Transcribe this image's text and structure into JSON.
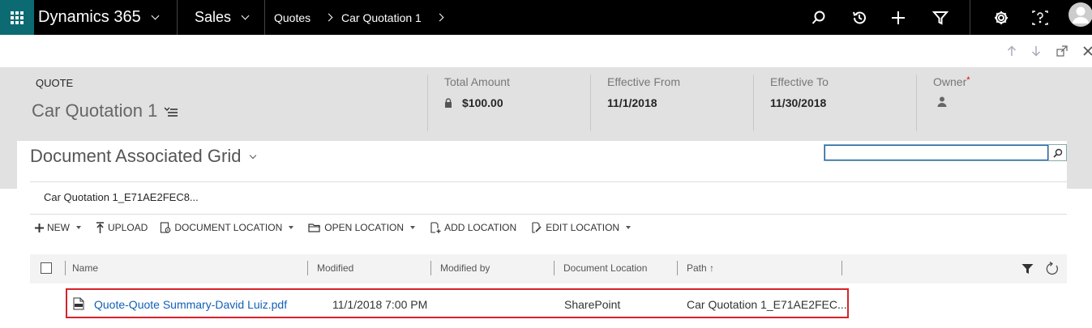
{
  "topnav": {
    "app_name": "Dynamics 365",
    "area_name": "Sales",
    "breadcrumb": [
      "Quotes",
      "Car Quotation 1"
    ],
    "icons": [
      "search-icon",
      "recent-icon",
      "plus-icon",
      "filter-icon",
      "gear-icon",
      "help-icon",
      "user-avatar"
    ]
  },
  "subbar": {
    "icons": [
      "arrow-up-icon",
      "arrow-down-icon",
      "popout-icon",
      "close-icon"
    ]
  },
  "header": {
    "entity_type": "QUOTE",
    "record_name": "Car Quotation 1",
    "fields": [
      {
        "label": "Total Amount",
        "value": "$100.00"
      },
      {
        "label": "Effective From",
        "value": "11/1/2018"
      },
      {
        "label": "Effective To",
        "value": "11/30/2018"
      },
      {
        "label": "Owner",
        "required_mark": "*",
        "value": ""
      }
    ]
  },
  "grid": {
    "title": "Document Associated Grid",
    "search_value": "",
    "folder_tab": "Car Quotation 1_E71AE2FEC8...",
    "commands": [
      {
        "label": "NEW",
        "icon": "plus-icon",
        "dropdown": true
      },
      {
        "label": "UPLOAD",
        "icon": "upload-icon",
        "dropdown": false
      },
      {
        "label": "DOCUMENT LOCATION",
        "icon": "document-location-icon",
        "dropdown": true
      },
      {
        "label": "OPEN LOCATION",
        "icon": "folder-icon",
        "dropdown": true
      },
      {
        "label": "ADD LOCATION",
        "icon": "add-location-icon",
        "dropdown": false
      },
      {
        "label": "EDIT LOCATION",
        "icon": "edit-location-icon",
        "dropdown": true
      }
    ],
    "columns": [
      "Name",
      "Modified",
      "Modified by",
      "Document Location",
      "Path ↑"
    ],
    "rows": [
      {
        "name": "Quote-Quote Summary-David Luiz.pdf",
        "modified": "11/1/2018 7:00 PM",
        "modified_by": "",
        "document_location": "SharePoint",
        "path": "Car Quotation 1_E71AE2FEC..."
      }
    ]
  },
  "colors": {
    "topbar": "#000000",
    "waffle": "#0b6a72",
    "header_bg": "#e1e1e1",
    "link": "#1160b7",
    "highlight": "#d8222a"
  }
}
